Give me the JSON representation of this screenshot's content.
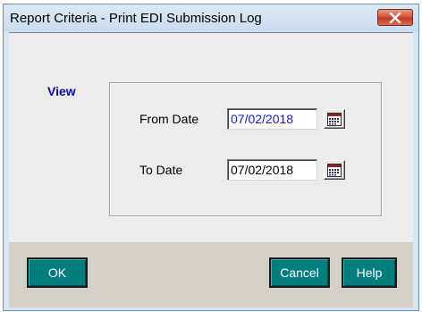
{
  "window": {
    "title": "Report Criteria - Print EDI Submission Log"
  },
  "view": {
    "label": "View",
    "from_label": "From Date",
    "from_value": "07/02/2018",
    "to_label": "To Date",
    "to_value": "07/02/2018"
  },
  "buttons": {
    "ok": "OK",
    "cancel": "Cancel",
    "help": "Help"
  },
  "icons": {
    "close": "close-icon",
    "calendar": "calendar-icon"
  },
  "colors": {
    "button_teal": "#007d7d",
    "view_label": "#0a0a9e",
    "close_red": "#c03a20"
  }
}
